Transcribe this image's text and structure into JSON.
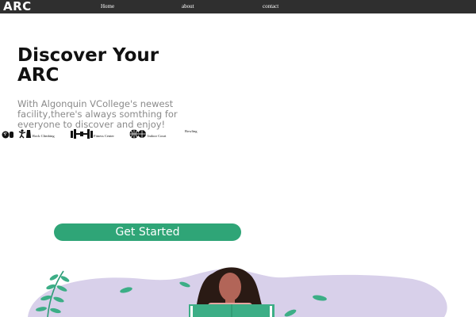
{
  "nav": {
    "logo": "ARC",
    "links": [
      "Home",
      "about",
      "contact"
    ]
  },
  "hero": {
    "title_line1": "Discover Your",
    "title_line2": "ARC",
    "subtitle_line1": "With Algonquin VCollege's newest",
    "subtitle_line2": "facility,there's always somthing for",
    "subtitle_line3": "everyone to discover and enjoy!"
  },
  "amenities": [
    {
      "label": "Rock Climbing",
      "icon": "climber-icon"
    },
    {
      "label": "Fitness Center",
      "icon": "dumbbell-icon"
    },
    {
      "label": "Indoor Court",
      "icon": "basketball-icon"
    },
    {
      "label": "Bowling",
      "icon": "bowling-ball-icon"
    }
  ],
  "cta": {
    "label": "Get Started"
  },
  "colors": {
    "nav_bg": "#2f2f2f",
    "accent_green": "#2fa577",
    "blob_lavender": "#d8d0ea",
    "leaf_green": "#3cae86",
    "hair": "#2a1a14",
    "skin": "#b26558"
  }
}
